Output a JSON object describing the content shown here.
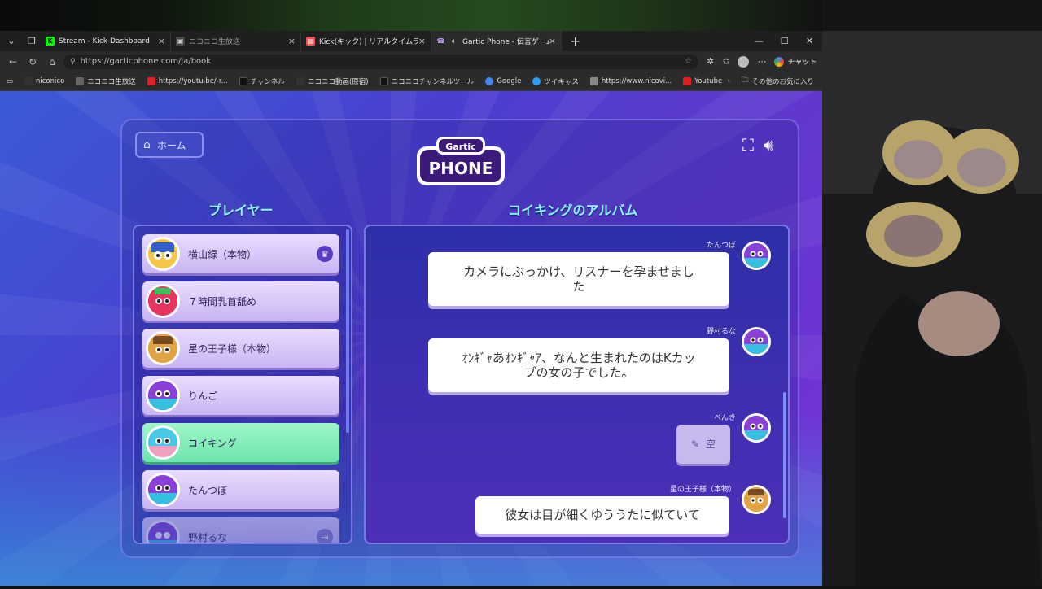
{
  "browser": {
    "tabs": [
      {
        "title": "Stream - Kick Dashboard",
        "icon": "kick-icon",
        "active": false
      },
      {
        "title": "ニコニコ生放送",
        "icon": "niconico-icon",
        "active": false
      },
      {
        "title": "Kick(キック) | リアルタイムランキング",
        "icon": "doc-icon",
        "active": false
      },
      {
        "title": "Gartic Phone - 伝言ゲーム",
        "icon": "gartic-icon",
        "active": true
      }
    ],
    "url": "https://garticphone.com/ja/book",
    "chat_label": "チャット",
    "bookmarks": [
      "niconico",
      "ニコニコ生放送",
      "https://youtu.be/-r...",
      "チャンネル",
      "ニコニコ動画(原宿)",
      "ニコニコチャンネルツール",
      "Google",
      "ツイキャス",
      "https://www.nicovi...",
      "Youtube"
    ],
    "other_bookmarks": "その他のお気に入り"
  },
  "game": {
    "home_label": "ホーム",
    "logo_top": "Gartic",
    "logo_bottom": "PHONE",
    "players_heading": "プレイヤー",
    "album_heading": "コイキングのアルバム",
    "players": [
      {
        "name": "横山緑（本物）",
        "host": true
      },
      {
        "name": "７時間乳首舐め"
      },
      {
        "name": "星の王子様（本物）"
      },
      {
        "name": "りんご"
      },
      {
        "name": "コイキング",
        "selected": true
      },
      {
        "name": "たんつぼ"
      },
      {
        "name": "野村るな"
      }
    ],
    "album": [
      {
        "author": "たんつぼ",
        "text_line1": "カメラにぶっかけ、リスナーを孕ませまし",
        "text_line2": "た"
      },
      {
        "author": "野村るな",
        "text_line1": "ｵﾝｷﾞｬあｵﾝｷﾞｬｱ、なんと生まれたのはKカッ",
        "text_line2": "プの女の子でした。"
      },
      {
        "author": "べんき",
        "empty_label": "空"
      },
      {
        "author": "星の王子様（本物）",
        "text_line1": "彼女は目が細くゆううたに似ていて"
      }
    ]
  },
  "colors": {
    "heading": "#8ff3ff",
    "player_bg": "#d9c8f7",
    "selected_bg": "#7febb7",
    "bubble": "#ffffff"
  }
}
